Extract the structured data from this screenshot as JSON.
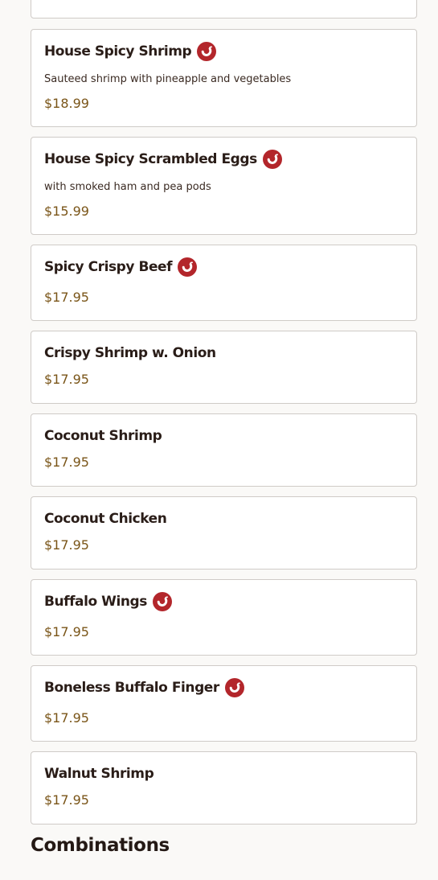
{
  "menu": {
    "section_heading": "Combinations",
    "colors": {
      "price": "#7a5518",
      "spicy_badge": "#b3262b",
      "card_border": "#cfcbc7",
      "background": "#faf9f7"
    },
    "items": [
      {
        "name": "",
        "description": "",
        "price": "",
        "spicy": false
      },
      {
        "name": "House Spicy Shrimp",
        "description": "Sauteed shrimp with pineapple and vegetables",
        "price": "$18.99",
        "spicy": true,
        "icon": "chili-pepper-icon"
      },
      {
        "name": "House Spicy Scrambled Eggs",
        "description": "with smoked ham and pea pods",
        "price": "$15.99",
        "spicy": true,
        "icon": "chili-pepper-icon"
      },
      {
        "name": "Spicy Crispy Beef",
        "description": "",
        "price": "$17.95",
        "spicy": true,
        "icon": "chili-pepper-icon"
      },
      {
        "name": "Crispy Shrimp w. Onion",
        "description": "",
        "price": "$17.95",
        "spicy": false
      },
      {
        "name": "Coconut Shrimp",
        "description": "",
        "price": "$17.95",
        "spicy": false
      },
      {
        "name": "Coconut Chicken",
        "description": "",
        "price": "$17.95",
        "spicy": false
      },
      {
        "name": "Buffalo Wings",
        "description": "",
        "price": "$17.95",
        "spicy": true,
        "icon": "chili-pepper-icon"
      },
      {
        "name": "Boneless Buffalo Finger",
        "description": "",
        "price": "$17.95",
        "spicy": true,
        "icon": "chili-pepper-icon"
      },
      {
        "name": "Walnut Shrimp",
        "description": "",
        "price": "$17.95",
        "spicy": false
      }
    ]
  }
}
